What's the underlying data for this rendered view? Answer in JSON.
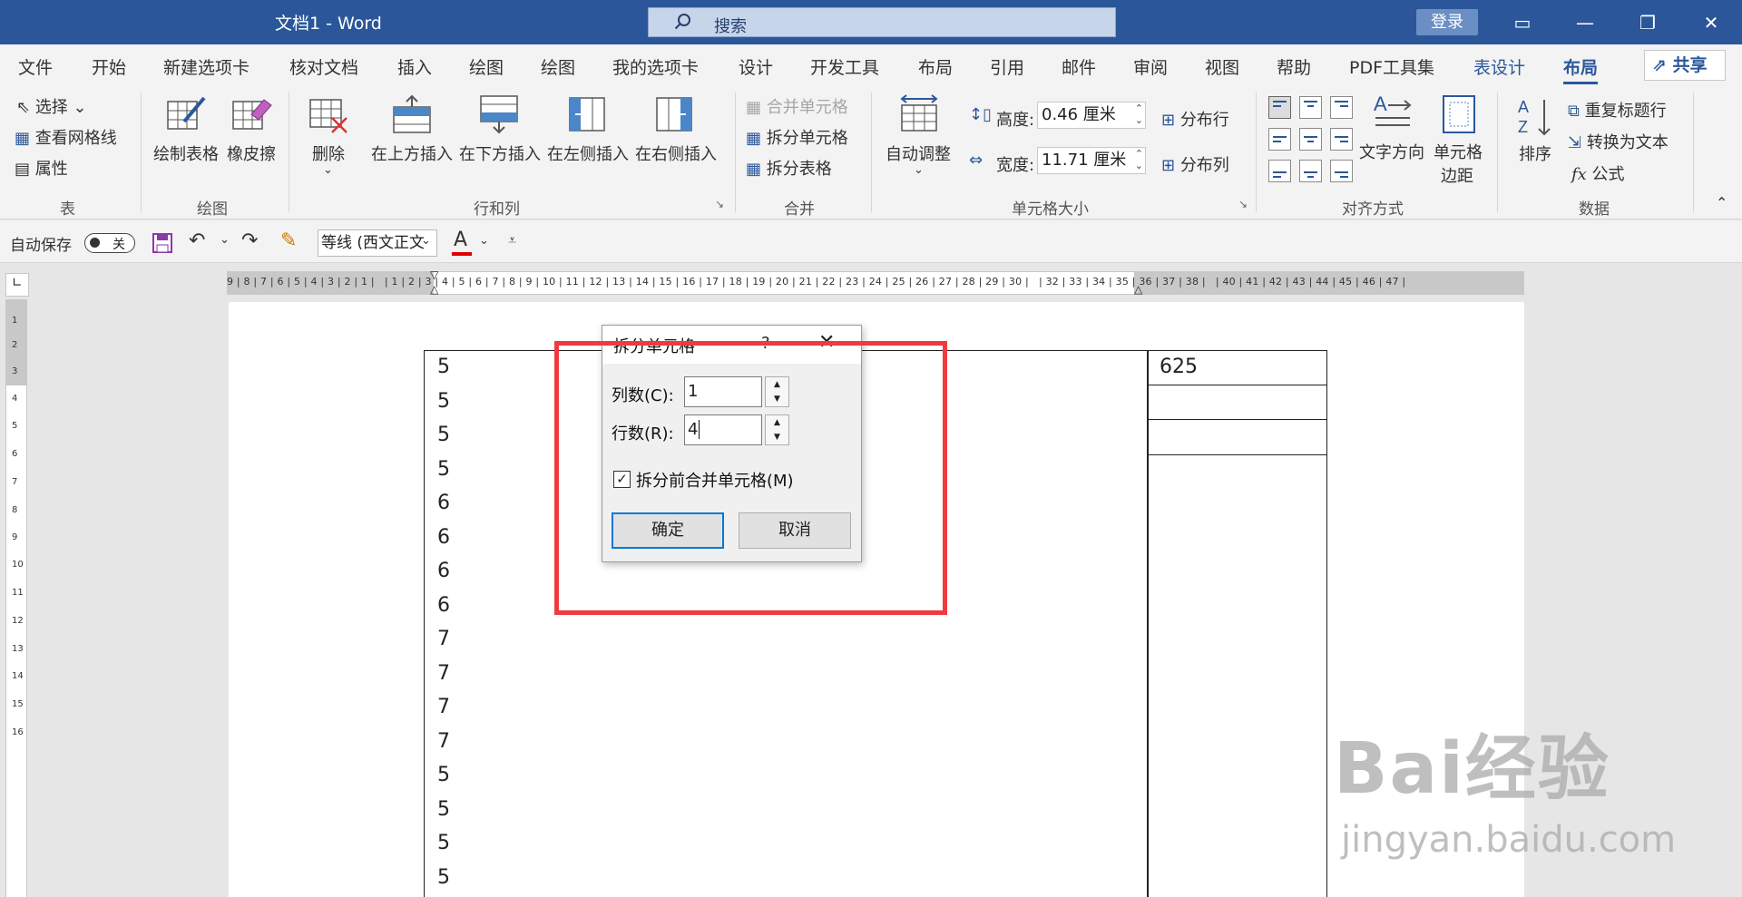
{
  "window": {
    "title": "文档1  -  Word",
    "search_placeholder": "搜索",
    "login": "登录"
  },
  "tabs": [
    "文件",
    "开始",
    "新建选项卡",
    "核对文档",
    "插入",
    "绘图",
    "绘图",
    "我的选项卡",
    "设计",
    "开发工具",
    "布局",
    "引用",
    "邮件",
    "审阅",
    "视图",
    "帮助",
    "PDF工具集",
    "表设计",
    "布局"
  ],
  "share": "共享",
  "ribbon": {
    "table_group": {
      "select": "选择",
      "view_gridlines": "查看网格线",
      "properties": "属性",
      "label": "表"
    },
    "draw_group": {
      "draw_table": "绘制表格",
      "eraser": "橡皮擦",
      "label": "绘图"
    },
    "rows_cols_group": {
      "delete": "删除",
      "insert_above": "在上方插入",
      "insert_below": "在下方插入",
      "insert_left": "在左侧插入",
      "insert_right": "在右侧插入",
      "label": "行和列"
    },
    "merge_group": {
      "merge_cells": "合并单元格",
      "split_cells": "拆分单元格",
      "split_table": "拆分表格",
      "label": "合并"
    },
    "cell_size_group": {
      "autofit": "自动调整",
      "height_label": "高度:",
      "height_value": "0.46 厘米",
      "width_label": "宽度:",
      "width_value": "11.71 厘米",
      "distribute_rows": "分布行",
      "distribute_cols": "分布列",
      "label": "单元格大小"
    },
    "alignment_group": {
      "text_direction": "文字方向",
      "cell_margins_1": "单元格",
      "cell_margins_2": "边距",
      "label": "对齐方式"
    },
    "data_group": {
      "sort": "排序",
      "repeat_header": "重复标题行",
      "convert_to_text": "转换为文本",
      "formula": "公式",
      "label": "数据"
    }
  },
  "qat": {
    "autosave_label": "自动保存",
    "autosave_state": "关",
    "font_name": "等线 (西文正文"
  },
  "ruler": {
    "h_text": "9 | 8 | 7 | 6 | 5 | 4 | 3 | 2 | 1 |   | 1 | 2 | 3 | 4 | 5 | 6 | 7 | 8 | 9 | 10 | 11 | 12 | 13 | 14 | 15 | 16 | 17 | 18 | 19 | 20 | 21 | 22 | 23 | 24 | 25 | 26 | 27 | 28 | 29 | 30 |   | 32 | 33 | 34 | 35 | 36 | 37 | 38 |   | 40 | 41 | 42 | 43 | 44 | 45 | 46 | 47 |",
    "v_numbers": [
      "1",
      "2",
      "3",
      "4",
      "5",
      "6",
      "7",
      "8",
      "9",
      "10",
      "11",
      "12",
      "13",
      "14",
      "15",
      "16"
    ]
  },
  "document": {
    "left_column": [
      "5",
      "5",
      "5",
      "5",
      "6",
      "6",
      "6",
      "6",
      "7",
      "7",
      "7",
      "7",
      "5",
      "5",
      "5",
      "5"
    ],
    "right_cell": "625"
  },
  "dialog": {
    "title": "拆分单元格",
    "help": "?",
    "cols_label": "列数(C):",
    "cols_value": "1",
    "rows_label": "行数(R):",
    "rows_value": "4",
    "merge_before_split": "拆分前合并单元格(M)",
    "merge_checked": true,
    "ok": "确定",
    "cancel": "取消"
  },
  "watermark": {
    "brand": "Bai经验",
    "url": "jingyan.baidu.com"
  },
  "colors": {
    "title_bar": "#2b579a",
    "highlight_box": "#ef3a3f"
  }
}
